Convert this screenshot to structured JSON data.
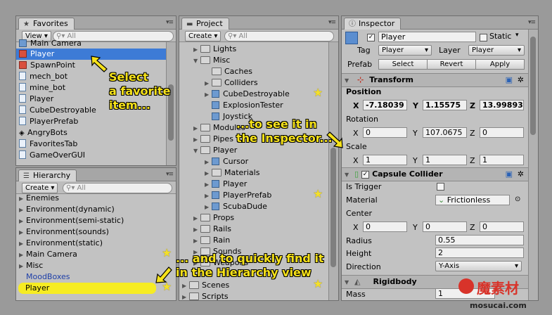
{
  "favorites": {
    "tab": "Favorites",
    "view_btn": "View",
    "search_placeholder": "All",
    "items": [
      "Main Camera",
      "Player",
      "SpawnPoint",
      "mech_bot",
      "mine_bot",
      "Player",
      "CubeDestroyable",
      "PlayerPrefab",
      "AngryBots",
      "FavoritesTab",
      "GameOverGUI"
    ]
  },
  "hierarchy": {
    "tab": "Hierarchy",
    "create_btn": "Create",
    "search_placeholder": "All",
    "items": [
      "Enemies",
      "Environment(dynamic)",
      "Environment(semi-static)",
      "Environment(sounds)",
      "Environment(static)",
      "Main Camera",
      "Misc",
      "MoodBoxes",
      "Player"
    ]
  },
  "project": {
    "tab": "Project",
    "create_btn": "Create",
    "search_placeholder": "All",
    "items": [
      "Lights",
      "Misc",
      "Caches",
      "Colliders",
      "CubeDestroyable",
      "ExplosionTester",
      "Joystick",
      "Modules",
      "Pipes",
      "Player",
      "Cursor",
      "Materials",
      "Player",
      "PlayerPrefab",
      "ScubaDude",
      "Props",
      "Rails",
      "Rain",
      "Sounds",
      "Weapons",
      "Scenes",
      "Scripts"
    ]
  },
  "inspector": {
    "tab": "Inspector",
    "name": "Player",
    "static_label": "Static",
    "tag_label": "Tag",
    "tag_value": "Player",
    "layer_label": "Layer",
    "layer_value": "Player",
    "prefab_label": "Prefab",
    "prefab_select": "Select",
    "prefab_revert": "Revert",
    "prefab_apply": "Apply",
    "transform": {
      "title": "Transform",
      "position_label": "Position",
      "rotation_label": "Rotation",
      "scale_label": "Scale",
      "pos": [
        "-7.18039",
        "1.15575",
        "13.99893"
      ],
      "rot": [
        "0",
        "107.0675",
        "0"
      ],
      "scale": [
        "1",
        "1",
        "1"
      ]
    },
    "capsule": {
      "title": "Capsule Collider",
      "is_trigger_label": "Is Trigger",
      "material_label": "Material",
      "material_value": "Frictionless",
      "center_label": "Center",
      "center": [
        "0",
        "0",
        "0"
      ],
      "radius_label": "Radius",
      "radius": "0.55",
      "height_label": "Height",
      "height": "2",
      "direction_label": "Direction",
      "direction": "Y-Axis"
    },
    "rigidbody": {
      "title": "Rigidbody",
      "mass_label": "Mass",
      "mass": "1"
    }
  },
  "callouts": {
    "c1": [
      "Select",
      "a favorite",
      "item..."
    ],
    "c2": [
      "...to see it in",
      "the Inspector..."
    ],
    "c3": [
      "... and to quickly find it",
      "in the Hierarchy view"
    ]
  },
  "axis": {
    "x": "X",
    "y": "Y",
    "z": "Z"
  },
  "watermark": {
    "main": "魔素材",
    "sub": "mosucai.com"
  }
}
